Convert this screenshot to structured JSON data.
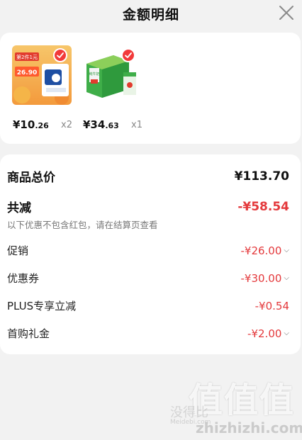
{
  "header": {
    "title": "金额明细"
  },
  "products": [
    {
      "price_main": "¥10",
      "price_decimal": ".26",
      "quantity": "x2",
      "image_badge_top": "第2件1元",
      "image_badge_price": "26.90"
    },
    {
      "price_main": "¥34",
      "price_decimal": ".63",
      "quantity": "x1",
      "image_box_text": "纯牛奶"
    }
  ],
  "summary": {
    "total_label": "商品总价",
    "total_value": "¥113.70",
    "discount_label": "共减",
    "discount_value": "-¥58.54",
    "discount_note": "以下优惠不包含红包，请在结算页查看",
    "rows": [
      {
        "label": "促销",
        "value": "-¥26.00",
        "expandable": true
      },
      {
        "label": "优惠券",
        "value": "-¥30.00",
        "expandable": true
      },
      {
        "label": "PLUS专享立减",
        "value": "-¥0.54",
        "expandable": false
      },
      {
        "label": "首购礼金",
        "value": "-¥2.00",
        "expandable": true
      }
    ]
  },
  "watermark": {
    "logo": "值值值",
    "text": "没得比",
    "small": "Meidebi.com",
    "url": "zhizhizhi.com"
  },
  "colors": {
    "accent_red": "#e4393c",
    "background": "#f2f2f2",
    "card": "#ffffff",
    "check_badge": "#f23a3a"
  },
  "icons": {
    "close": "close-icon",
    "selected": "check-icon",
    "expand": "chevron-down-icon"
  }
}
